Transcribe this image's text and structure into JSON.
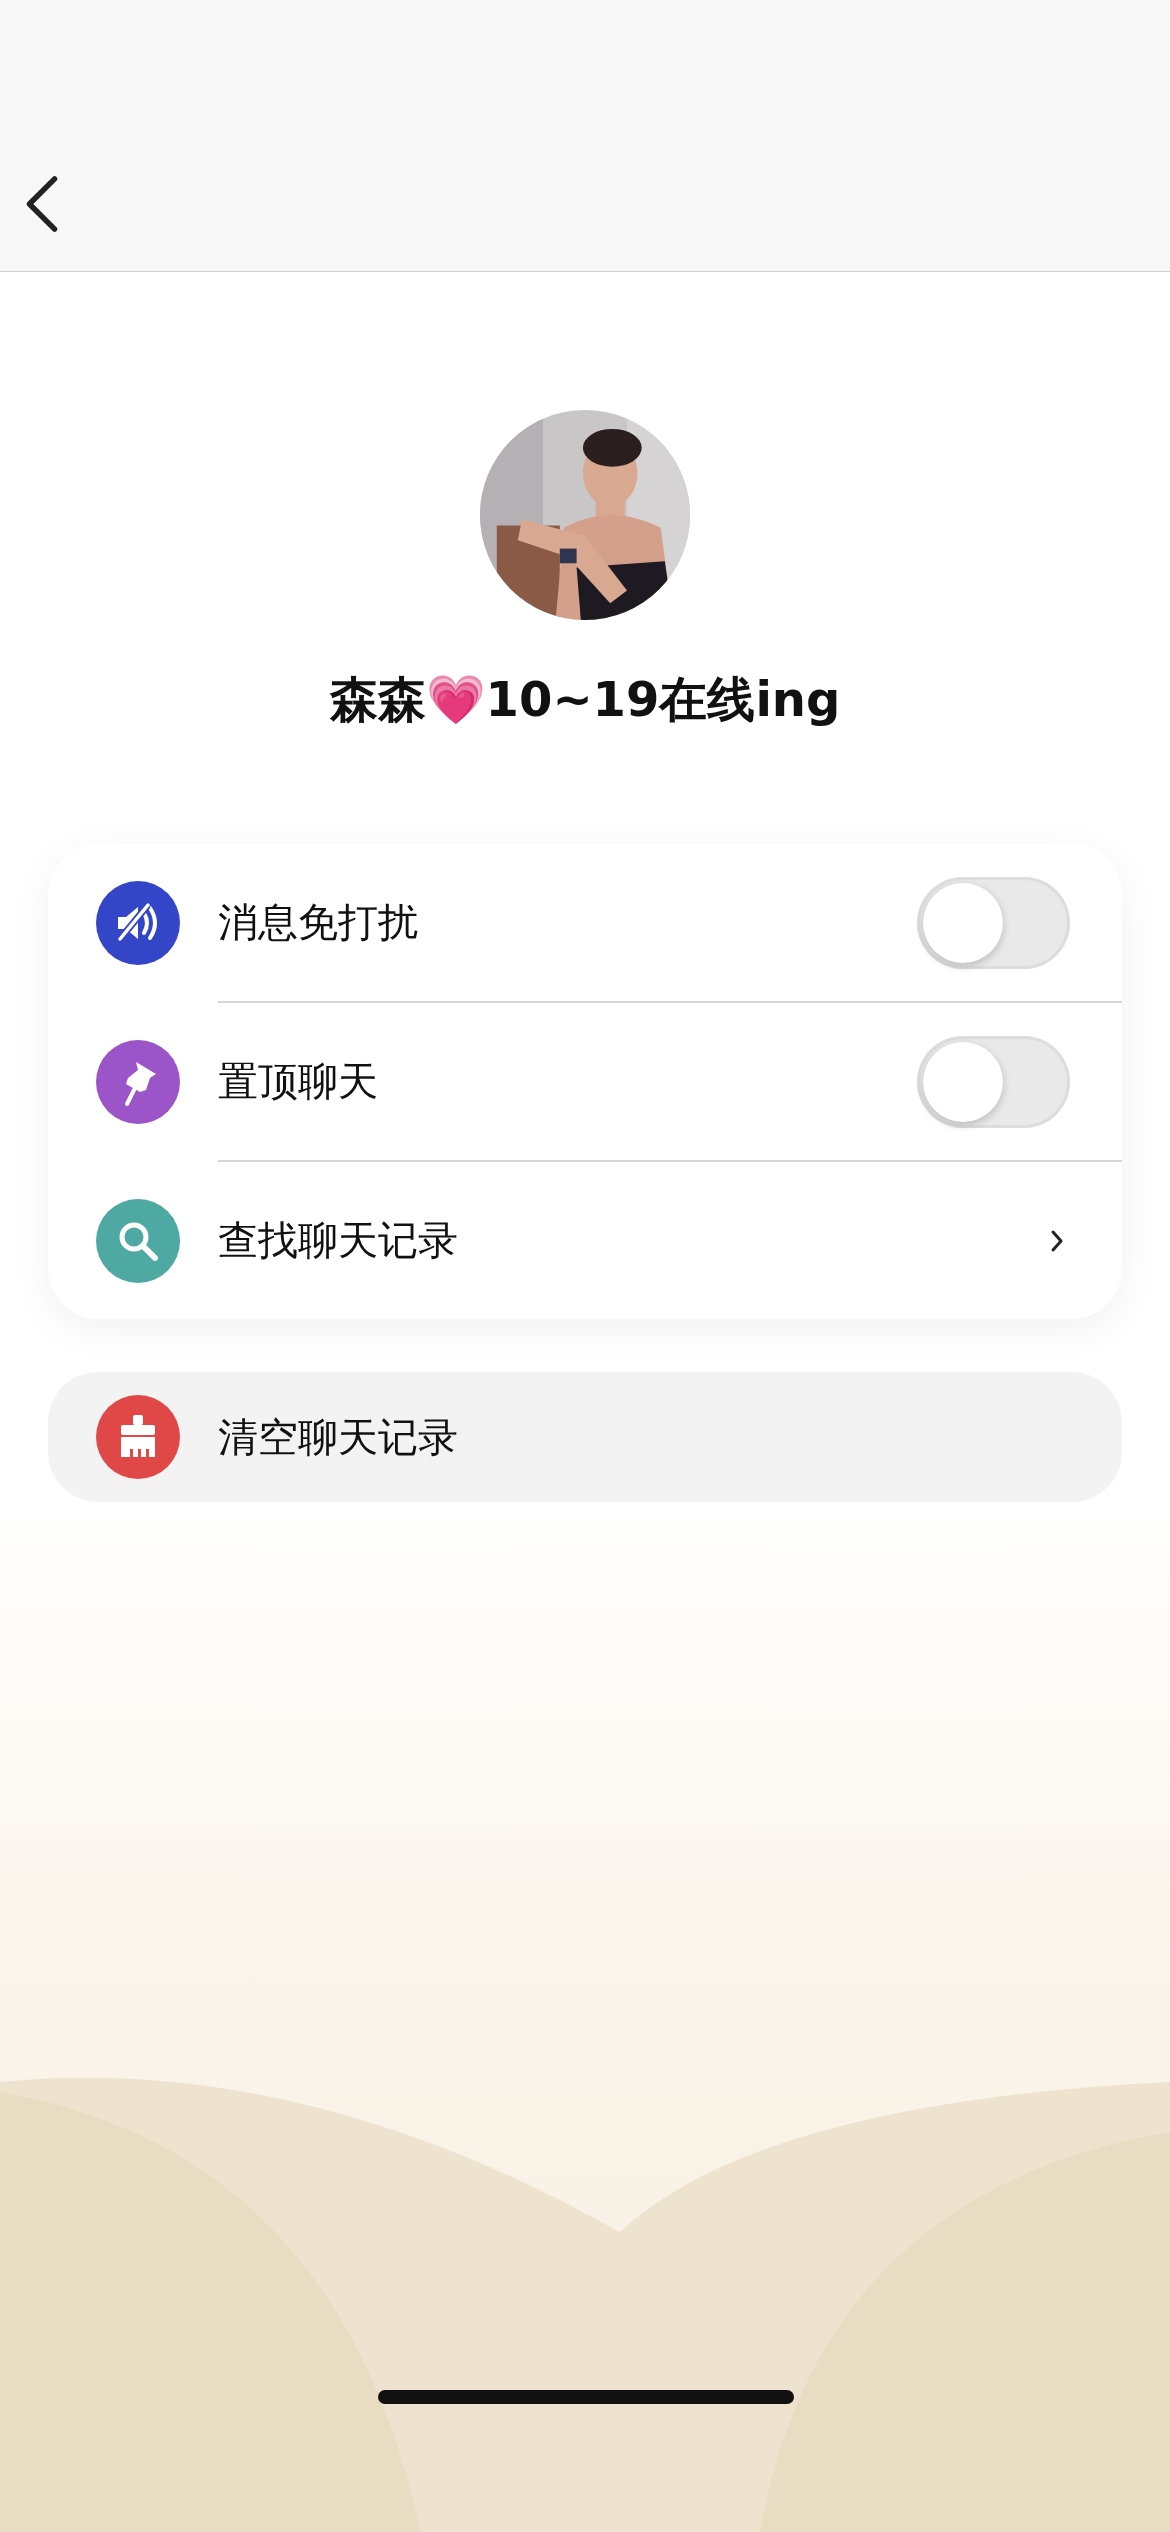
{
  "profile": {
    "name": "森森💗10~19在线ing"
  },
  "settings": [
    {
      "kind": "toggle",
      "label": "消息免打扰",
      "color": "#3346c8",
      "on": false
    },
    {
      "kind": "toggle",
      "label": "置顶聊天",
      "color": "#9b55c8",
      "on": false
    },
    {
      "kind": "link",
      "label": "查找聊天记录",
      "color": "#4ea9a2"
    }
  ],
  "danger": {
    "label": "清空聊天记录",
    "color": "#e04848"
  }
}
